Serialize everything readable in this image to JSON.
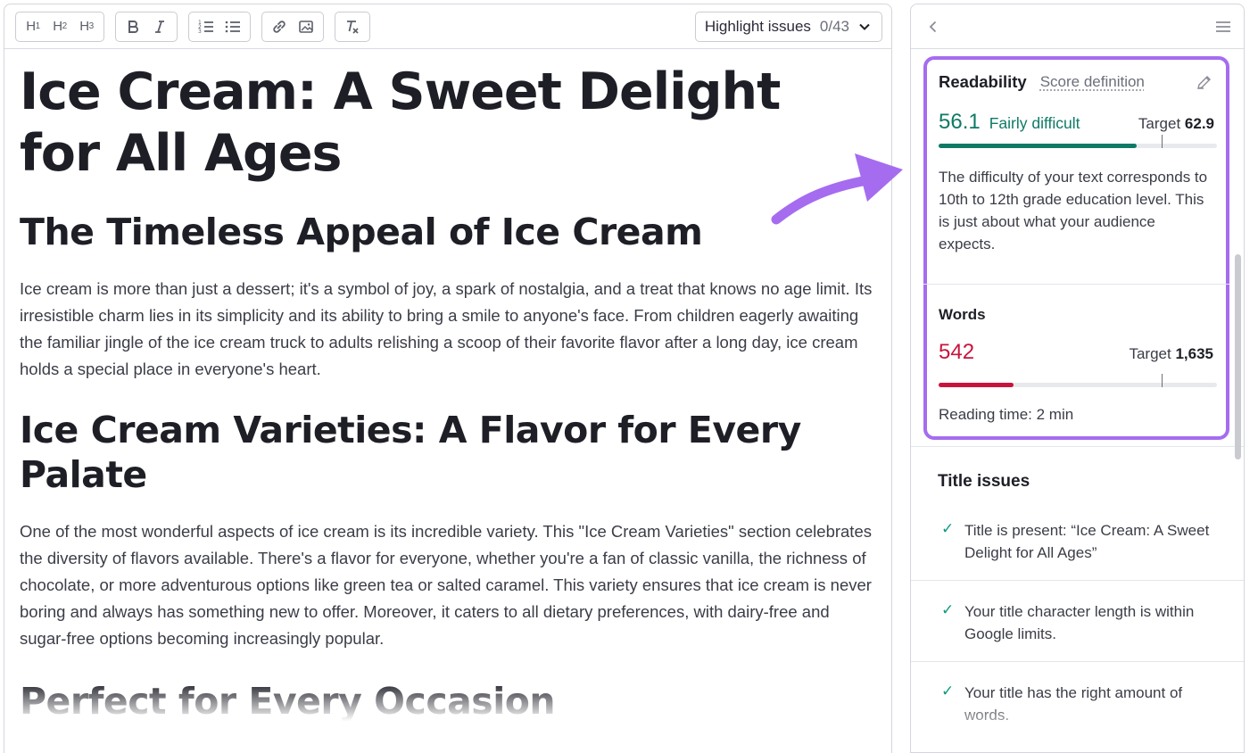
{
  "toolbar": {
    "headings": [
      "H1",
      "H2",
      "H3"
    ],
    "format": [
      "bold-icon",
      "italic-icon"
    ],
    "lists": [
      "ordered-list-icon",
      "bullet-list-icon"
    ],
    "insert": [
      "link-icon",
      "image-icon"
    ],
    "clear": "clear-format-icon",
    "highlight_label": "Highlight issues",
    "highlight_count": "0/43"
  },
  "document": {
    "title": "Ice Cream: A Sweet Delight for All Ages",
    "section1_heading": "The Timeless Appeal of Ice Cream",
    "section1_text": "Ice cream is more than just a dessert; it's a symbol of joy, a spark of nostalgia, and a treat that knows no age limit. Its irresistible charm lies in its simplicity and its ability to bring a smile to anyone's face. From children eagerly awaiting the familiar jingle of the ice cream truck to adults relishing a scoop of their favorite flavor after a long day, ice cream holds a special place in everyone's heart.",
    "section2_heading": "Ice Cream Varieties: A Flavor for Every Palate",
    "section2_text": "One of the most wonderful aspects of ice cream is its incredible variety. This \"Ice Cream Varieties\" section celebrates the diversity of flavors available. There's a flavor for everyone, whether you're a fan of classic vanilla, the richness of chocolate, or more adventurous options like green tea or salted caramel. This variety ensures that ice cream is never boring and always has something new to offer. Moreover, it caters to all dietary preferences, with dairy-free and sugar-free options becoming increasingly popular.",
    "section3_heading": "Perfect for Every Occasion"
  },
  "readability": {
    "title": "Readability",
    "score_definition": "Score definition",
    "score": "56.1",
    "score_label": "Fairly difficult",
    "target_label": "Target",
    "target_value": "62.9",
    "score_fraction": 0.71,
    "target_fraction": 0.8,
    "description": "The difficulty of your text corresponds to 10th to 12th grade education level. This is just about what your audience expects.",
    "score_color": "#0e7a66"
  },
  "words": {
    "title": "Words",
    "count": "542",
    "target_label": "Target",
    "target_value": "1,635",
    "count_fraction": 0.27,
    "target_fraction": 0.8,
    "reading_time": "Reading time: 2 min",
    "count_color": "#c8143c"
  },
  "title_issues": {
    "title": "Title issues",
    "items": [
      "Title is present: “Ice Cream: A Sweet Delight for All Ages”",
      "Your title character length is within Google limits.",
      "Your title has the right amount of words."
    ]
  },
  "accent_color": "#a56cf0"
}
